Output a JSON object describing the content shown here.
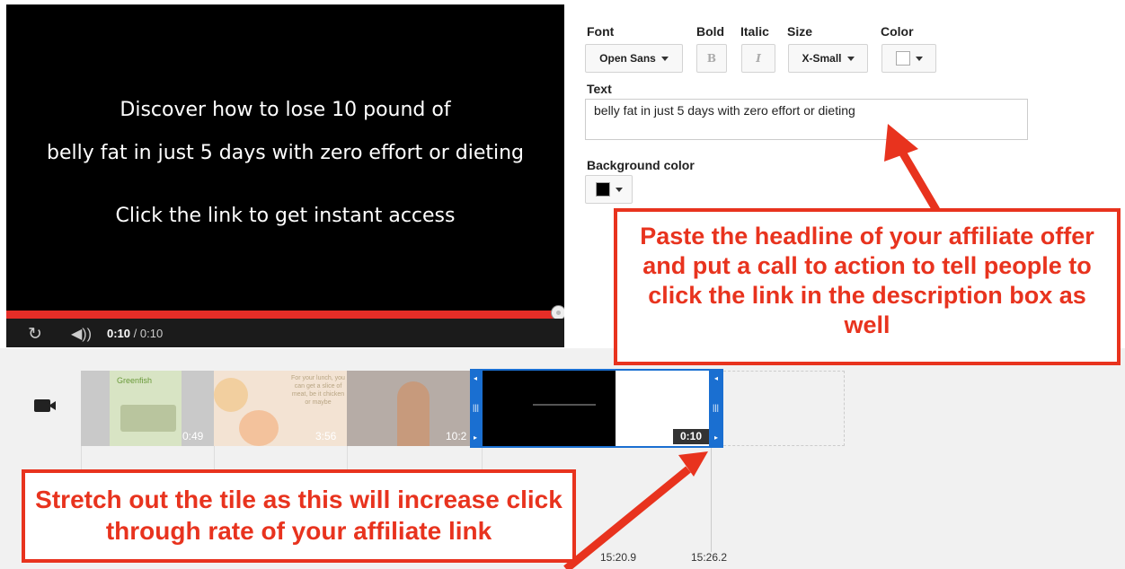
{
  "video": {
    "lines": [
      "Discover how to lose 10 pound of",
      "belly fat in just 5 days with zero effort or dieting",
      "Click the link to get instant access"
    ],
    "current_time": "0:10",
    "total_time": "/ 0:10",
    "progress": 1.0
  },
  "editor": {
    "font_label": "Font",
    "font_value": "Open Sans",
    "bold_label": "Bold",
    "bold_glyph": "B",
    "italic_label": "Italic",
    "italic_glyph": "I",
    "size_label": "Size",
    "size_value": "X-Small",
    "color_label": "Color",
    "color_value": "#ffffff",
    "text_label": "Text",
    "text_value": "belly fat in just 5 days with zero effort or dieting",
    "bg_color_label": "Background color",
    "bg_color_value": "#000000"
  },
  "callouts": {
    "headline": "Paste the headline of your affiliate offer and put a call to action to tell people to click the link in the description box as well",
    "stretch": "Stretch out the tile as this will increase click through rate of your affiliate link"
  },
  "timeline": {
    "tiles": [
      {
        "duration": "0:49",
        "thumb_text": "Greenfish"
      },
      {
        "duration": "3:56",
        "thumb_text": "For your lunch, you can get a slice of meat, be it chicken or maybe"
      },
      {
        "duration": "10:2",
        "thumb_text": ""
      }
    ],
    "selected_duration": "0:10",
    "ruler": [
      "15:20.9",
      "15:26.2"
    ]
  },
  "colors": {
    "accent": "#e8331e",
    "progress": "#e52d27",
    "handle": "#1a6fd1"
  }
}
